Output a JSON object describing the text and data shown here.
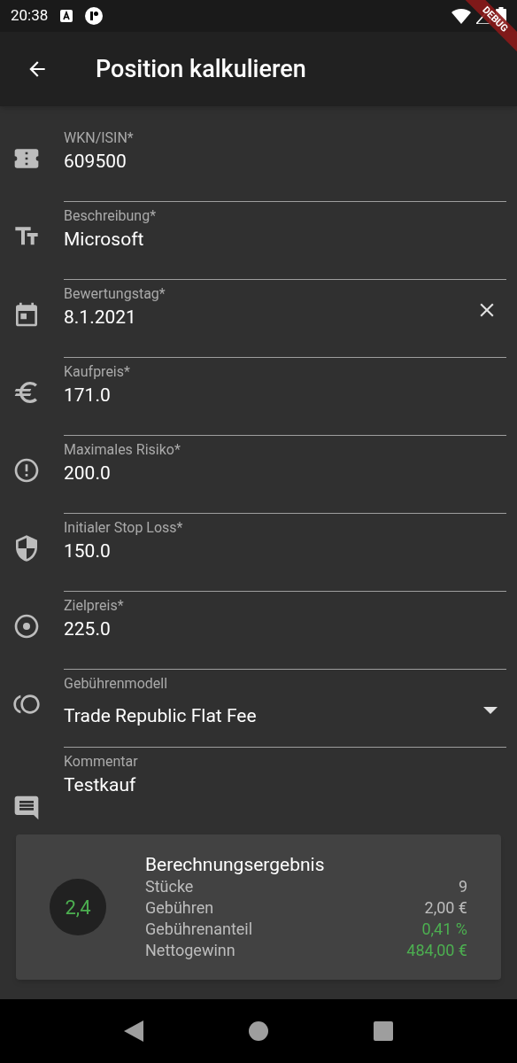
{
  "status_bar": {
    "time": "20:38"
  },
  "debug_banner": "DEBUG",
  "app_bar": {
    "title": "Position kalkulieren"
  },
  "fields": [
    {
      "kind": "text",
      "label": "WKN/ISIN*",
      "value": "609500"
    },
    {
      "kind": "text",
      "label": "Beschreibung*",
      "value": "Microsoft"
    },
    {
      "kind": "date",
      "label": "Bewertungstag*",
      "value": "8.1.2021"
    },
    {
      "kind": "text",
      "label": "Kaufpreis*",
      "value": "171.0"
    },
    {
      "kind": "text",
      "label": "Maximales Risiko*",
      "value": "200.0"
    },
    {
      "kind": "text",
      "label": "Initialer Stop Loss*",
      "value": "150.0"
    },
    {
      "kind": "text",
      "label": "Zielpreis*",
      "value": "225.0"
    },
    {
      "kind": "dropdown",
      "label": "Gebührenmodell",
      "value": "Trade Republic Flat Fee"
    },
    {
      "kind": "comment",
      "label": "Kommentar",
      "value": "Testkauf"
    }
  ],
  "result": {
    "badge": "2,4",
    "title": "Berechnungsergebnis",
    "rows": [
      {
        "label": "Stücke",
        "value": "9",
        "color": "#bdbdbd"
      },
      {
        "label": "Gebühren",
        "value": "2,00 €",
        "color": "#bdbdbd"
      },
      {
        "label": "Gebührenanteil",
        "value": "0,41 %",
        "color": "#4caf50"
      },
      {
        "label": "Nettogewinn",
        "value": "484,00 €",
        "color": "#4caf50"
      }
    ]
  }
}
